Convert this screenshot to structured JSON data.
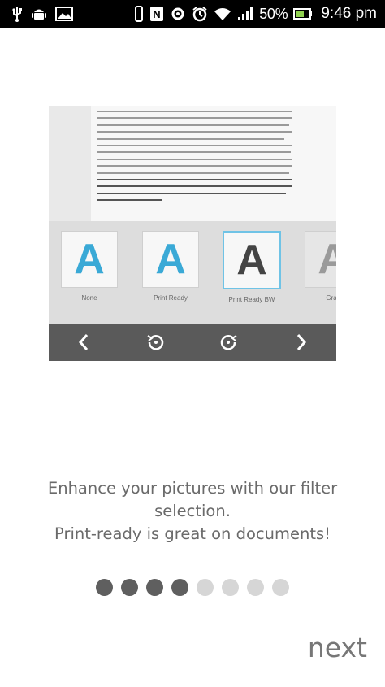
{
  "status_bar": {
    "battery_percent": "50%",
    "time": "9:46 pm",
    "icons": [
      "usb-icon",
      "android-icon",
      "image-icon",
      "vibrate-icon",
      "nfc-icon",
      "settings-sync-icon",
      "alarm-icon",
      "wifi-icon",
      "signal-icon",
      "battery-icon"
    ]
  },
  "preview": {
    "filters": [
      {
        "letter": "A",
        "label": "None",
        "color": "#3aa9d6",
        "selected": false
      },
      {
        "letter": "A",
        "label": "Print Ready",
        "color": "#3aa9d6",
        "selected": false
      },
      {
        "letter": "A",
        "label": "Print Ready BW",
        "color": "#444444",
        "selected": true
      },
      {
        "letter": "A",
        "label": "Gray",
        "color": "#9a9a9a",
        "selected": false
      }
    ],
    "toolbar_icons": [
      "chevron-left-icon",
      "rotate-left-icon",
      "rotate-right-icon",
      "chevron-right-icon"
    ]
  },
  "message": {
    "line1": "Enhance your pictures with our filter",
    "line2": "selection.",
    "line3": "Print-ready is great on documents!"
  },
  "pager": {
    "total": 8,
    "active_through": 4,
    "active_color": "#5f5f5f",
    "inactive_color": "#d6d6d6"
  },
  "next_label": "next"
}
